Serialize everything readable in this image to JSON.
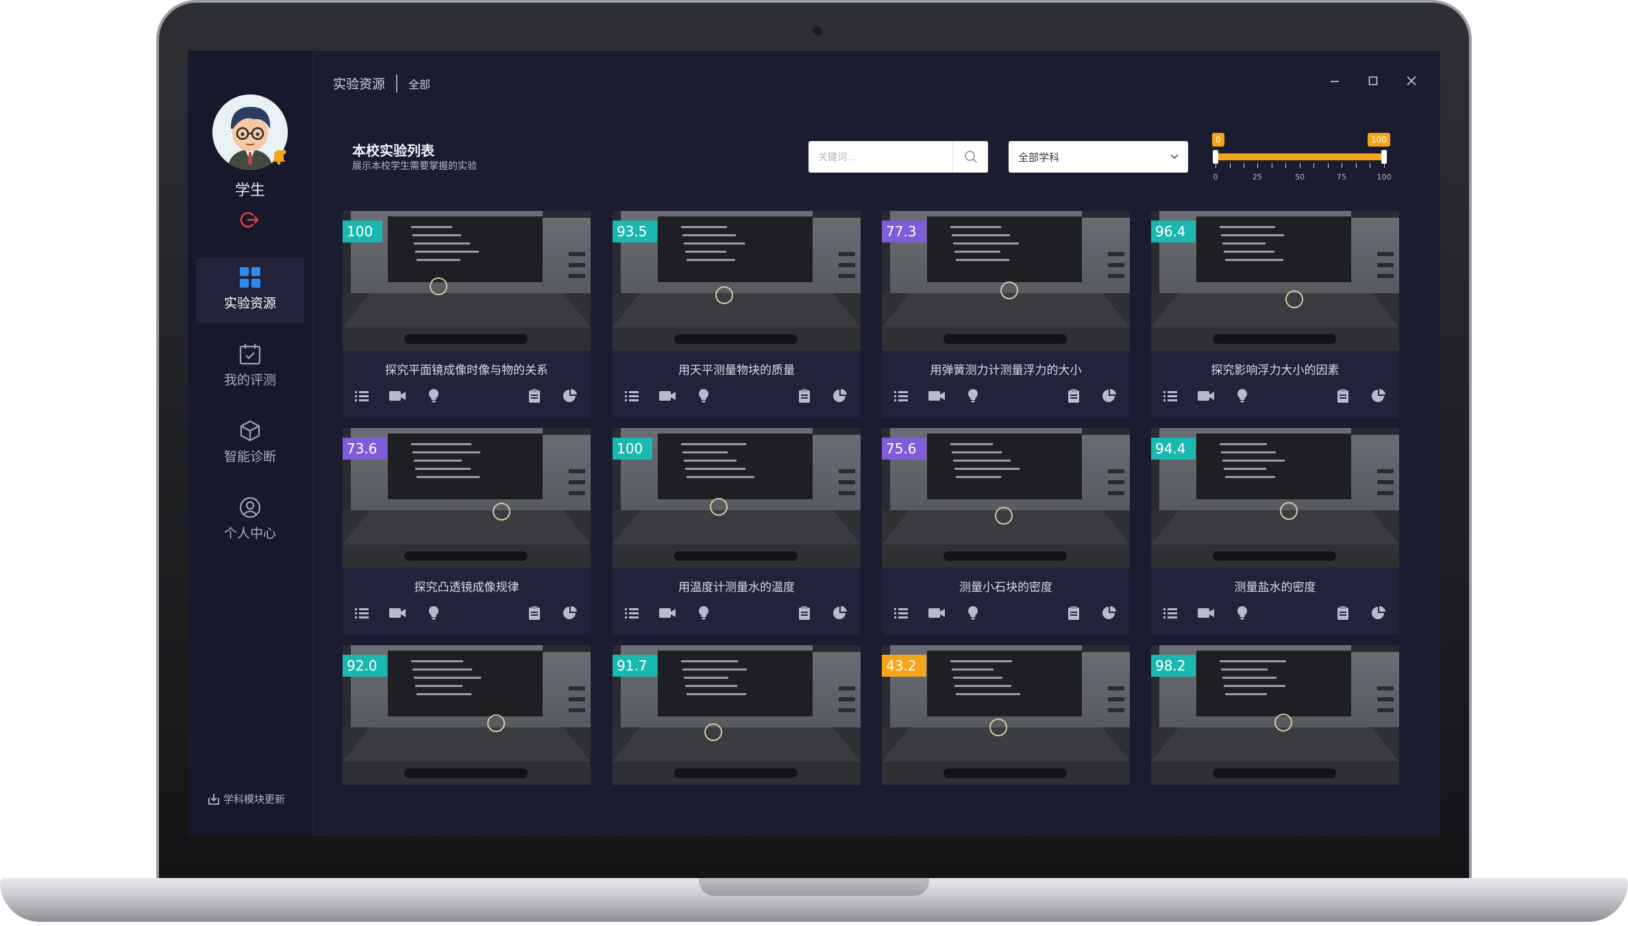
{
  "app": {
    "breadcrumb_main": "实验资源",
    "breadcrumb_sub": "全部",
    "window_controls": [
      "minimize-icon",
      "maximize-icon",
      "close-icon"
    ]
  },
  "sidebar": {
    "role": "学生",
    "items": [
      {
        "label": "实验资源",
        "icon": "grid-icon",
        "active": true
      },
      {
        "label": "我的评测",
        "icon": "calendar-check-icon",
        "active": false
      },
      {
        "label": "智能诊断",
        "icon": "cube-icon",
        "active": false
      },
      {
        "label": "个人中心",
        "icon": "user-circle-icon",
        "active": false
      }
    ],
    "update_label": "学科模块更新"
  },
  "header": {
    "title": "本校实验列表",
    "subtitle": "展示本校学生需要掌握的实验"
  },
  "search": {
    "placeholder": "关键词..."
  },
  "subject_select": {
    "value": "全部学科"
  },
  "score_range": {
    "min_value": "0",
    "max_value": "100",
    "tick_labels": [
      "0",
      "25",
      "50",
      "75",
      "100"
    ]
  },
  "colors": {
    "score_teal": "#1bb8b0",
    "score_purple": "#7f5cd8",
    "score_orange": "#f5a51c",
    "accent_blue": "#2d8cf0"
  },
  "cards": [
    {
      "score": "100",
      "badge_color": "#1bb8b0",
      "title": "探究平面镜成像时像与物的关系"
    },
    {
      "score": "93.5",
      "badge_color": "#1bb8b0",
      "title": "用天平测量物块的质量"
    },
    {
      "score": "77.3",
      "badge_color": "#7f5cd8",
      "title": "用弹簧测力计测量浮力的大小"
    },
    {
      "score": "96.4",
      "badge_color": "#1bb8b0",
      "title": "探究影响浮力大小的因素"
    },
    {
      "score": "73.6",
      "badge_color": "#7f5cd8",
      "title": "探究凸透镜成像规律"
    },
    {
      "score": "100",
      "badge_color": "#1bb8b0",
      "title": "用温度计测量水的温度"
    },
    {
      "score": "75.6",
      "badge_color": "#7f5cd8",
      "title": "测量小石块的密度"
    },
    {
      "score": "94.4",
      "badge_color": "#1bb8b0",
      "title": "测量盐水的密度"
    },
    {
      "score": "92.0",
      "badge_color": "#1bb8b0",
      "title": ""
    },
    {
      "score": "91.7",
      "badge_color": "#1bb8b0",
      "title": ""
    },
    {
      "score": "43.2",
      "badge_color": "#f5a51c",
      "title": ""
    },
    {
      "score": "98.2",
      "badge_color": "#1bb8b0",
      "title": ""
    }
  ],
  "card_action_icons": [
    "list-icon",
    "video-icon",
    "lightbulb-icon",
    "clipboard-icon",
    "pie-chart-icon"
  ]
}
